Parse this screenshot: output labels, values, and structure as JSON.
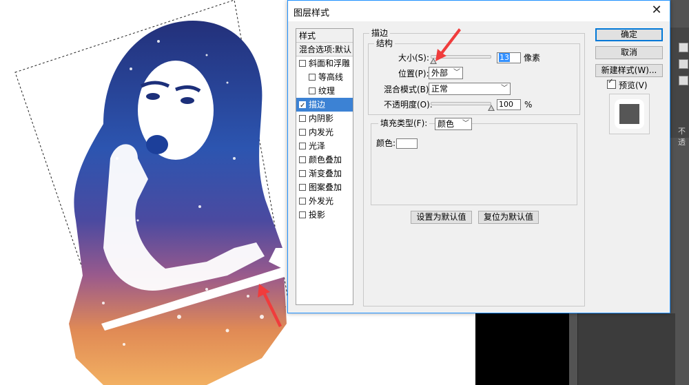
{
  "dialog": {
    "title": "图层样式",
    "close_symbol": "✕"
  },
  "styles_panel": {
    "header": "样式",
    "blend_options": "混合选项:默认",
    "items": [
      {
        "label": "斜面和浮雕",
        "checked": false,
        "indent": false,
        "selected": false
      },
      {
        "label": "等高线",
        "checked": false,
        "indent": true,
        "selected": false
      },
      {
        "label": "纹理",
        "checked": false,
        "indent": true,
        "selected": false
      },
      {
        "label": "描边",
        "checked": true,
        "indent": false,
        "selected": true
      },
      {
        "label": "内阴影",
        "checked": false,
        "indent": false,
        "selected": false
      },
      {
        "label": "内发光",
        "checked": false,
        "indent": false,
        "selected": false
      },
      {
        "label": "光泽",
        "checked": false,
        "indent": false,
        "selected": false
      },
      {
        "label": "颜色叠加",
        "checked": false,
        "indent": false,
        "selected": false
      },
      {
        "label": "渐变叠加",
        "checked": false,
        "indent": false,
        "selected": false
      },
      {
        "label": "图案叠加",
        "checked": false,
        "indent": false,
        "selected": false
      },
      {
        "label": "外发光",
        "checked": false,
        "indent": false,
        "selected": false
      },
      {
        "label": "投影",
        "checked": false,
        "indent": false,
        "selected": false
      }
    ]
  },
  "stroke": {
    "group_title": "描边",
    "structure_title": "结构",
    "size_label": "大小(S):",
    "size_value": "13",
    "size_unit": "像素",
    "position_label": "位置(P):",
    "position_value": "外部",
    "blend_mode_label": "混合模式(B):",
    "blend_mode_value": "正常",
    "opacity_label": "不透明度(O):",
    "opacity_value": "100",
    "opacity_unit": "%",
    "fill_type_label": "填充类型(F):",
    "fill_type_value": "颜色",
    "color_label": "颜色:",
    "stroke_color": "#ffffff",
    "size_slider_fraction": 0.05,
    "opacity_slider_fraction": 1.0
  },
  "buttons": {
    "make_default": "设置为默认值",
    "reset_default": "复位为默认值",
    "ok": "确定",
    "cancel": "取消",
    "new_style": "新建样式(W)...",
    "preview": "预览(V)",
    "preview_checked": true
  },
  "background_panel": {
    "fragment_1": "不透"
  },
  "colors": {
    "accent": "#3c82d4",
    "annotation_arrow": "#f03c3c",
    "dialog_border": "#1e90ff"
  }
}
